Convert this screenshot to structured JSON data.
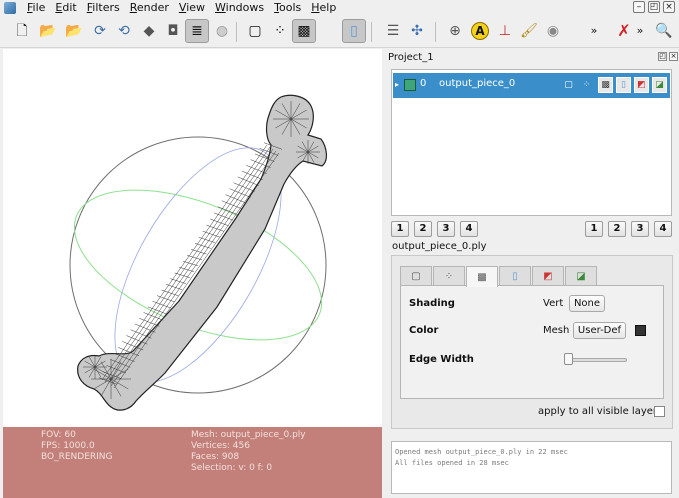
{
  "menu": {
    "items": [
      "File",
      "Edit",
      "Filters",
      "Render",
      "View",
      "Windows",
      "Tools",
      "Help"
    ]
  },
  "toolbar": {
    "overflow_glyph": "»",
    "overflow2_glyph": "»",
    "buttons": [
      {
        "name": "new-project-icon",
        "glyph": "🗋"
      },
      {
        "name": "open-project-icon",
        "glyph": "📂"
      },
      {
        "name": "import-mesh-icon",
        "glyph": "📂"
      },
      {
        "name": "reload-icon",
        "glyph": "⟳"
      },
      {
        "name": "reload-all-icon",
        "glyph": "⟲"
      },
      {
        "name": "export-mesh-icon",
        "glyph": "◆"
      },
      {
        "name": "snapshot-icon",
        "glyph": "◘"
      },
      {
        "name": "layers-icon",
        "glyph": "≣"
      },
      {
        "name": "bbox-icon",
        "glyph": "▢"
      },
      {
        "name": "points-icon",
        "glyph": "⁘"
      },
      {
        "name": "wireframe-icon",
        "glyph": "▩"
      },
      {
        "name": "flat-lines-icon",
        "glyph": "▯"
      },
      {
        "name": "stack-icon",
        "glyph": "☰"
      },
      {
        "name": "transform-icon",
        "glyph": "✣"
      },
      {
        "name": "globe-icon",
        "glyph": "⊕"
      },
      {
        "name": "annotate-icon",
        "glyph": "A"
      },
      {
        "name": "axes-icon",
        "glyph": "⊥"
      },
      {
        "name": "paint-icon",
        "glyph": "🖌"
      },
      {
        "name": "camera-icon",
        "glyph": "◉"
      },
      {
        "name": "no-selection-icon",
        "glyph": "✗"
      },
      {
        "name": "search-icon",
        "glyph": "🔍"
      }
    ]
  },
  "viewport": {
    "info_left": [
      "FOV: 60",
      "FPS:  1000.0",
      "BO_RENDERING"
    ],
    "info_right": [
      "Mesh: output_piece_0.ply",
      "Vertices: 456",
      "Faces: 908",
      "Selection: v: 0 f: 0"
    ]
  },
  "project": {
    "title": "Project_1",
    "layer": {
      "expander": "▸",
      "index": "0",
      "name": "output_piece_0"
    },
    "view_buttons_left": [
      "1",
      "2",
      "3",
      "4"
    ],
    "view_buttons_right": [
      "1",
      "2",
      "3",
      "4"
    ]
  },
  "decoration": {
    "mesh_name": "output_piece_0.ply",
    "tabs": [
      "▢",
      "⁘",
      "▩",
      "▯",
      "◩",
      "◪"
    ],
    "shading_label": "Shading",
    "shading_sub": "Vert",
    "shading_value": "None",
    "color_label": "Color",
    "color_sub": "Mesh",
    "color_value": "User-Def",
    "edge_label": "Edge Width",
    "apply_label": "apply to all visible layers"
  },
  "log": {
    "lines": [
      "Opened mesh output_piece_0.ply in 22 msec",
      "All files opened in 28 msec"
    ]
  },
  "colors": {
    "selection_blue": "#3a8fcb",
    "info_panel": "#c3807a",
    "wire": "#333333"
  }
}
